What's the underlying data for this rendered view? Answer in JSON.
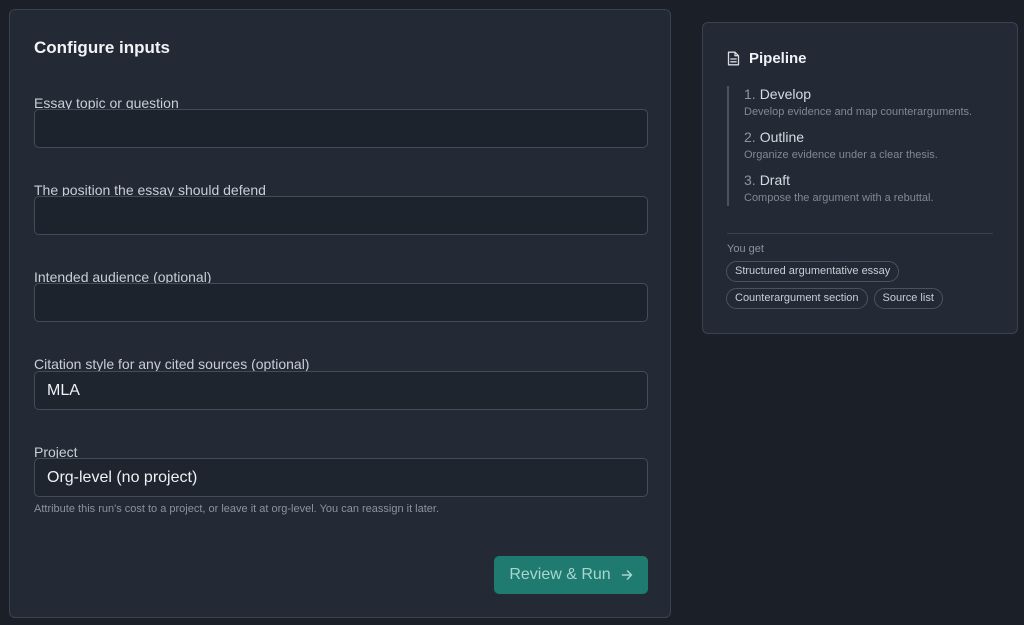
{
  "config": {
    "title": "Configure inputs",
    "fields": [
      {
        "label": "Essay topic or question",
        "value": ""
      },
      {
        "label": "The position the essay should defend",
        "value": ""
      },
      {
        "label": "Intended audience (optional)",
        "value": ""
      },
      {
        "label": "Citation style for any cited sources (optional)",
        "value": "MLA"
      },
      {
        "label": "Project",
        "value": "Org-level (no project)"
      }
    ],
    "project_help": "Attribute this run's cost to a project, or leave it at org-level. You can reassign it later.",
    "run_label": "Review & Run",
    "run_icon": "arrow-right-icon",
    "accent_color": "#1f7a70"
  },
  "pipeline": {
    "title": "Pipeline",
    "title_icon": "document-icon",
    "steps": [
      {
        "num": "1.",
        "title": "Develop",
        "desc": "Develop evidence and map counterarguments."
      },
      {
        "num": "2.",
        "title": "Outline",
        "desc": "Organize evidence under a clear thesis."
      },
      {
        "num": "3.",
        "title": "Draft",
        "desc": "Compose the argument with a rebuttal."
      }
    ],
    "you_get_label": "You get",
    "outputs": [
      "Structured argumentative essay",
      "Counterargument section",
      "Source list"
    ]
  }
}
